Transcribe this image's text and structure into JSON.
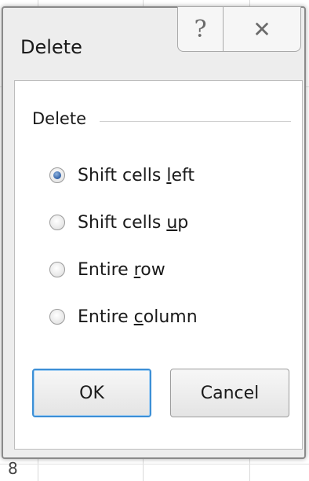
{
  "dialog": {
    "title": "Delete",
    "help_glyph": "?",
    "close_glyph": "✕"
  },
  "group": {
    "label": "Delete",
    "options": [
      {
        "pre": "Shift cells ",
        "mnemonic": "l",
        "post": "eft",
        "checked": true
      },
      {
        "pre": "Shift cells ",
        "mnemonic": "u",
        "post": "p",
        "checked": false
      },
      {
        "pre": "Entire ",
        "mnemonic": "r",
        "post": "ow",
        "checked": false
      },
      {
        "pre": "Entire ",
        "mnemonic": "c",
        "post": "olumn",
        "checked": false
      }
    ]
  },
  "buttons": {
    "ok": "OK",
    "cancel": "Cancel"
  },
  "background": {
    "row_number": "8"
  },
  "colors": {
    "ok_focus_border": "#3c8fd6",
    "radio_selected": "#2f5fa5"
  }
}
